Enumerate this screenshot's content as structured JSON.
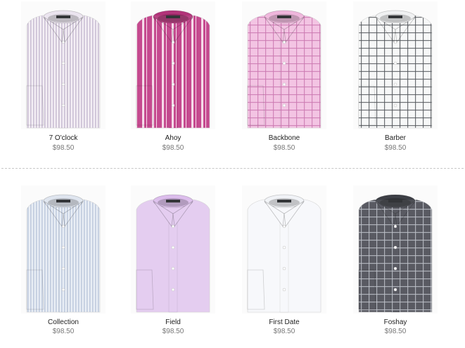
{
  "products": [
    {
      "name": "7 O'clock",
      "price": "$98.50",
      "base": "#f3eef5",
      "stripe": "#9a86ad",
      "pattern": "thin-stripe",
      "collar": "#ebe4ef"
    },
    {
      "name": "Ahoy",
      "price": "$98.50",
      "base": "#c03b86",
      "stripe": "#f6d9e8",
      "pattern": "wide-stripe",
      "collar": "#b23379"
    },
    {
      "name": "Backbone",
      "price": "$98.50",
      "base": "#f2bfe1",
      "stripe": "#c86fab",
      "pattern": "check",
      "collar": "#efb6dc"
    },
    {
      "name": "Barber",
      "price": "$98.50",
      "base": "#f7f8f8",
      "stripe": "#474a50",
      "pattern": "check",
      "collar": "#f0f1f2"
    },
    {
      "name": "Collection",
      "price": "$98.50",
      "base": "#e8edf5",
      "stripe": "#8fa1c2",
      "pattern": "thin-stripe",
      "collar": "#dfe5ef"
    },
    {
      "name": "Field",
      "price": "$98.50",
      "base": "#e2c9ef",
      "stripe": "#caa8df",
      "pattern": "solid",
      "collar": "#dcbdec"
    },
    {
      "name": "First Date",
      "price": "$98.50",
      "base": "#f7f8fb",
      "stripe": "#dfe2ea",
      "pattern": "solid",
      "collar": "#f1f3f7"
    },
    {
      "name": "Foshay",
      "price": "$98.50",
      "base": "#4b4d55",
      "stripe": "#b9bcc3",
      "pattern": "check",
      "collar": "#3d3f46"
    }
  ]
}
